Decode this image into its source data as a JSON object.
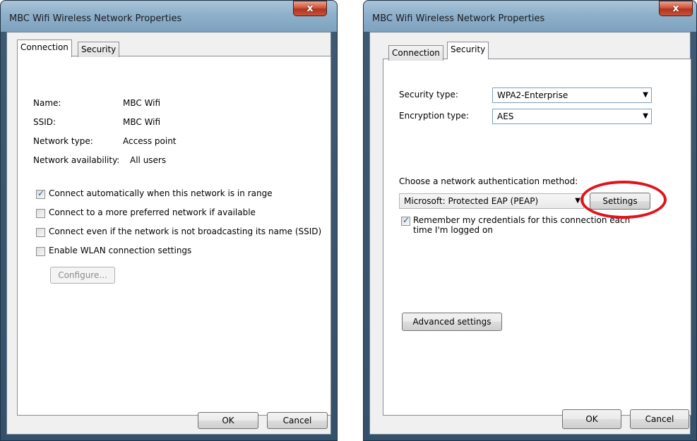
{
  "left_dialog": {
    "title": "MBC Wifi Wireless Network Properties",
    "close_label": "x",
    "tabs": [
      {
        "label": "Connection"
      },
      {
        "label": "Security"
      }
    ],
    "info": [
      {
        "label": "Name:",
        "value": "MBC Wifi"
      },
      {
        "label": "SSID:",
        "value": "MBC Wifi"
      },
      {
        "label": "Network type:",
        "value": "Access point"
      },
      {
        "label": "Network availability:",
        "value": "All users"
      }
    ],
    "options": [
      {
        "label": "Connect automatically when this network is in range",
        "checked": true
      },
      {
        "label": "Connect to a more preferred network if available",
        "checked": false
      },
      {
        "label": "Connect even if the network is not broadcasting its name (SSID)",
        "checked": false
      },
      {
        "label": "Enable WLAN connection settings",
        "checked": false
      }
    ],
    "configure_label": "Configure...",
    "ok_label": "OK",
    "cancel_label": "Cancel"
  },
  "right_dialog": {
    "title": "MBC Wifi Wireless Network Properties",
    "close_label": "x",
    "tabs": [
      {
        "label": "Connection"
      },
      {
        "label": "Security"
      }
    ],
    "security_type_label": "Security type:",
    "security_type_value": "WPA2-Enterprise",
    "encryption_type_label": "Encryption type:",
    "encryption_type_value": "AES",
    "auth_method_label": "Choose a network authentication method:",
    "auth_method_value": "Microsoft: Protected EAP (PEAP)",
    "settings_label": "Settings",
    "remember_line1": "Remember my credentials for this connection each",
    "remember_line2": "time I'm logged on",
    "remember_checked": true,
    "advanced_label": "Advanced settings",
    "ok_label": "OK",
    "cancel_label": "Cancel",
    "highlight_color": "#e0141b"
  },
  "glyphs": {
    "check": "✓",
    "dropdown": "▼"
  }
}
